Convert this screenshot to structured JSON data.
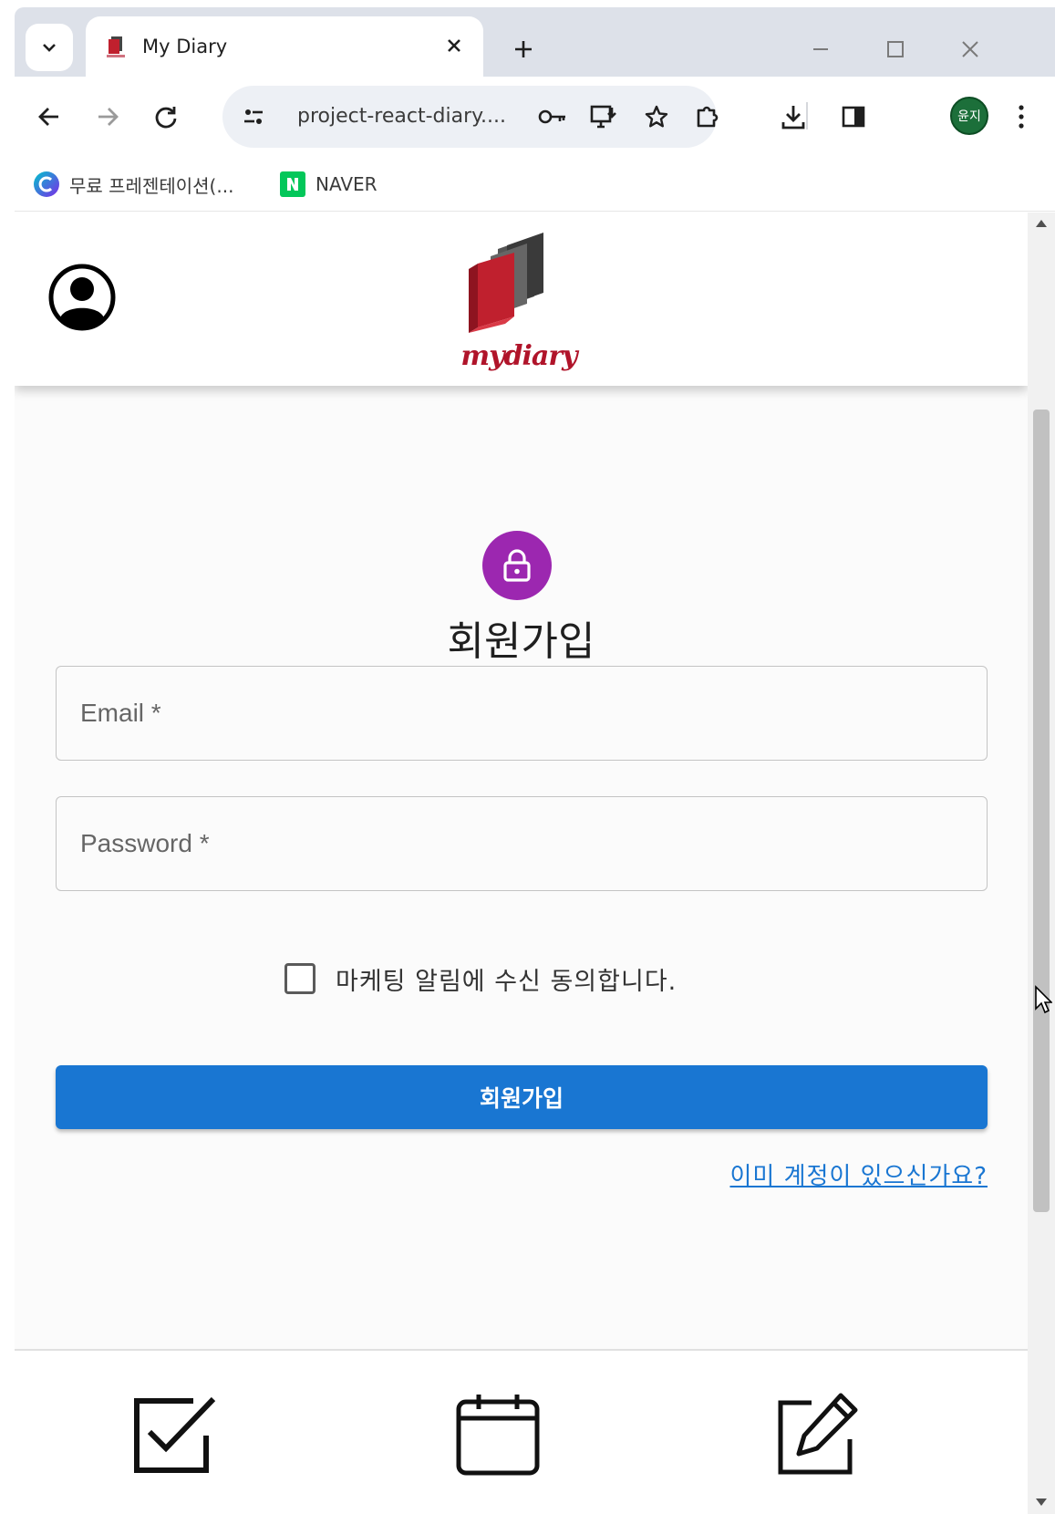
{
  "browser": {
    "tab_title": "My Diary",
    "url": "project-react-diary....",
    "profile_initials": "윤지",
    "bookmarks": [
      {
        "label": "무료 프레젠테이션(..."
      },
      {
        "label": "NAVER"
      }
    ]
  },
  "header": {
    "logo_text": "mydiary"
  },
  "form": {
    "title": "회원가입",
    "email_placeholder": "Email *",
    "password_placeholder": "Password *",
    "consent_label": "마케팅 알림에 수신 동의합니다.",
    "consent_checked": false,
    "submit_label": "회원가입",
    "login_link": "이미 계정이 있으신가요?"
  },
  "colors": {
    "avatar": "#9c27b0",
    "primary": "#1976d2",
    "logo": "#b0142a",
    "naver": "#03c75a"
  },
  "icons": {
    "header_left": "account-circle-icon",
    "avatar": "lock-icon",
    "footer": [
      "checkbox-icon",
      "calendar-icon",
      "edit-icon"
    ]
  }
}
